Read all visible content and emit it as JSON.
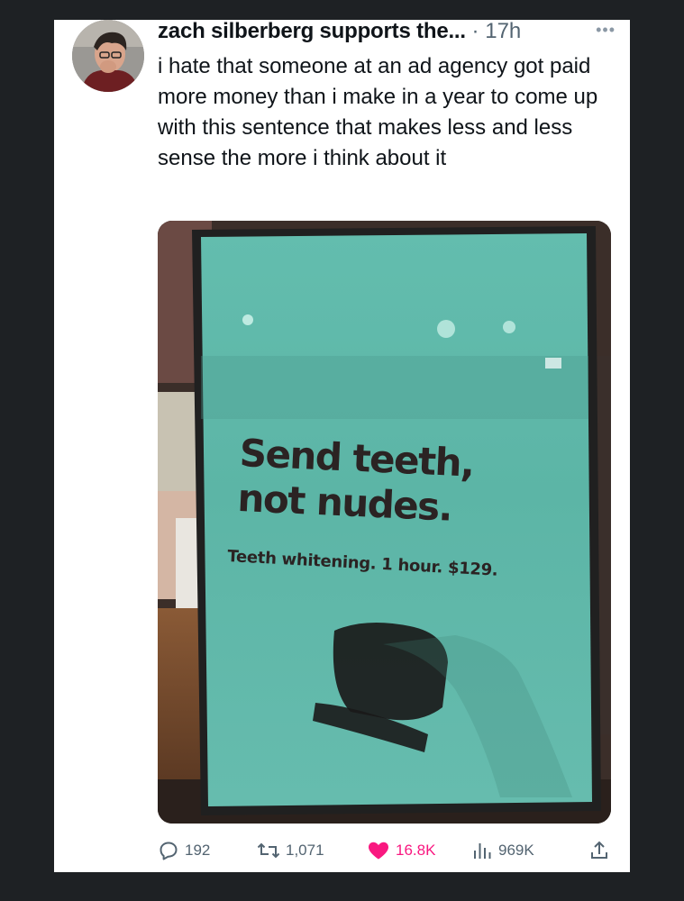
{
  "tweet": {
    "display_name": "zach silberberg supports the...",
    "separator": "·",
    "time": "17h",
    "more_label": "•••",
    "text": "i hate that someone at an ad agency got paid more money than i make in a year to come up with this sentence that makes less and less sense the more i think about it"
  },
  "photo": {
    "sign_headline": "Send teeth,\nnot nudes.",
    "sign_subline": "Teeth whitening. 1 hour. $129."
  },
  "actions": {
    "replies": "192",
    "reposts": "1,071",
    "likes": "16.8K",
    "views": "969K"
  },
  "colors": {
    "background": "#1e2124",
    "card": "#ffffff",
    "text": "#0f1419",
    "secondary": "#536471",
    "like": "#f91880",
    "sign": "#5fb8a8"
  }
}
